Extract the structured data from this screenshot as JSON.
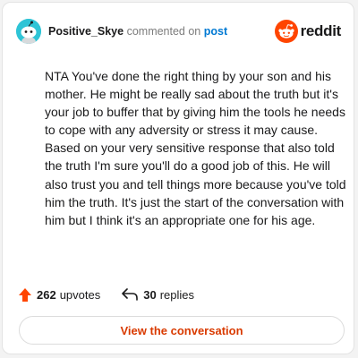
{
  "header": {
    "username": "Positive_Skye",
    "action_text": "commented on",
    "post_link": "post",
    "brand_name": "reddit"
  },
  "comment": {
    "text": "NTA You've done the right thing by your son and his mother. He might be really sad about the truth but it's your job to buffer that by giving him the tools he needs to cope with any adversity or stress it may cause. Based on your very sensitive response that also told the truth I'm sure you'll do a good job of this. He will also trust you and tell things more because you've told him the truth. It's just the start of the conversation with him but I think it's an appropriate one for his age."
  },
  "stats": {
    "upvotes_count": "262",
    "upvotes_label": "upvotes",
    "replies_count": "30",
    "replies_label": "replies"
  },
  "cta": {
    "label": "View the conversation"
  },
  "icons": {
    "avatar": "snoo-avatar-icon",
    "brand": "reddit-logo-icon",
    "upvote": "upvote-arrow-icon",
    "reply": "reply-arrow-icon"
  },
  "colors": {
    "avatar_bg": "#2ec4d6",
    "brand_orange": "#ff4500",
    "link_blue": "#0079d3",
    "cta_text": "#d93a00"
  }
}
